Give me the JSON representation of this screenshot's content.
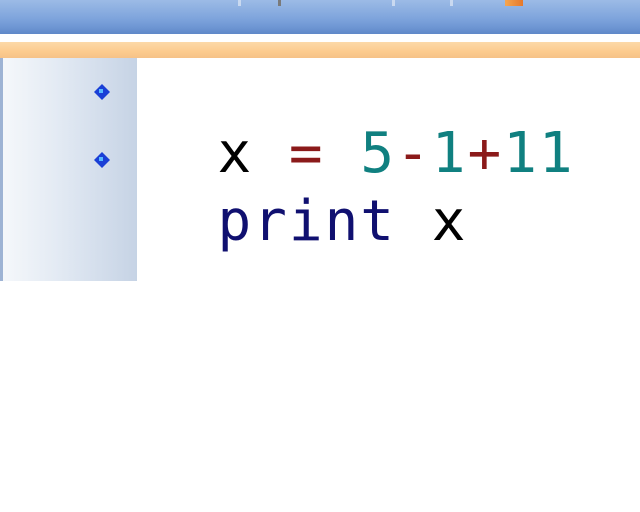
{
  "editor": {
    "lines": [
      {
        "tokens": [
          {
            "text": "x",
            "kind": "var"
          },
          {
            "text": " ",
            "kind": "space"
          },
          {
            "text": "=",
            "kind": "op"
          },
          {
            "text": " ",
            "kind": "space"
          },
          {
            "text": "5",
            "kind": "num"
          },
          {
            "text": "-",
            "kind": "op"
          },
          {
            "text": "1",
            "kind": "num"
          },
          {
            "text": "+",
            "kind": "op"
          },
          {
            "text": "11",
            "kind": "num"
          }
        ]
      },
      {
        "tokens": [
          {
            "text": "print",
            "kind": "kw"
          },
          {
            "text": " ",
            "kind": "space"
          },
          {
            "text": "x",
            "kind": "var"
          }
        ]
      }
    ]
  },
  "colors": {
    "variable": "#000000",
    "operator": "#8b1a1a",
    "number": "#108080",
    "keyword": "#101070",
    "bullet": "#1a3fd6",
    "toolbar": "#7ea4dc",
    "highlight_band": "#fccb8e"
  },
  "icons": {
    "line_marker": "blue-bullet-icon"
  }
}
